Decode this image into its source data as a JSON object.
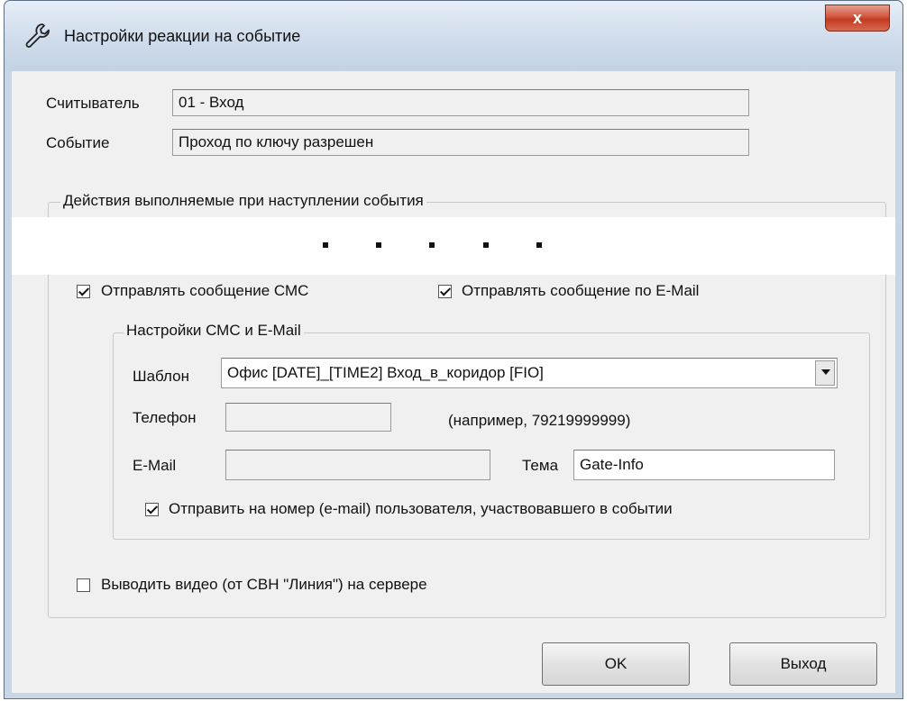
{
  "window": {
    "title": "Настройки реакции на событие",
    "close_glyph": "x",
    "icon": "wrench-icon"
  },
  "reader": {
    "label": "Считыватель",
    "value": "01 - Вход"
  },
  "event": {
    "label": "Событие",
    "value": "Проход по ключу разрешен"
  },
  "actions_group": {
    "title": "Действия выполняемые при наступлении события"
  },
  "notifications": {
    "send_sms": {
      "label": "Отправлять сообщение СМС",
      "checked": true
    },
    "send_email": {
      "label": "Отправлять сообщение по E-Mail",
      "checked": true
    }
  },
  "sms_email_group": {
    "title": "Настройки СМС и E-Mail",
    "template": {
      "label": "Шаблон",
      "value": "Офис [DATE]_[TIME2] Вход_в_коридор [FIO]"
    },
    "phone": {
      "label": "Телефон",
      "value": "",
      "hint": "(например, 79219999999)"
    },
    "email": {
      "label": "E-Mail",
      "value": ""
    },
    "subject": {
      "label": "Тема",
      "value": "Gate-Info"
    },
    "send_to_participant": {
      "label": "Отправить на номер (e-mail) пользователя, участвовавшего в событии",
      "checked": true
    }
  },
  "video": {
    "label": "Выводить видео (от СВН \"Линия\") на сервере",
    "checked": false
  },
  "buttons": {
    "ok": "OK",
    "exit": "Выход"
  }
}
